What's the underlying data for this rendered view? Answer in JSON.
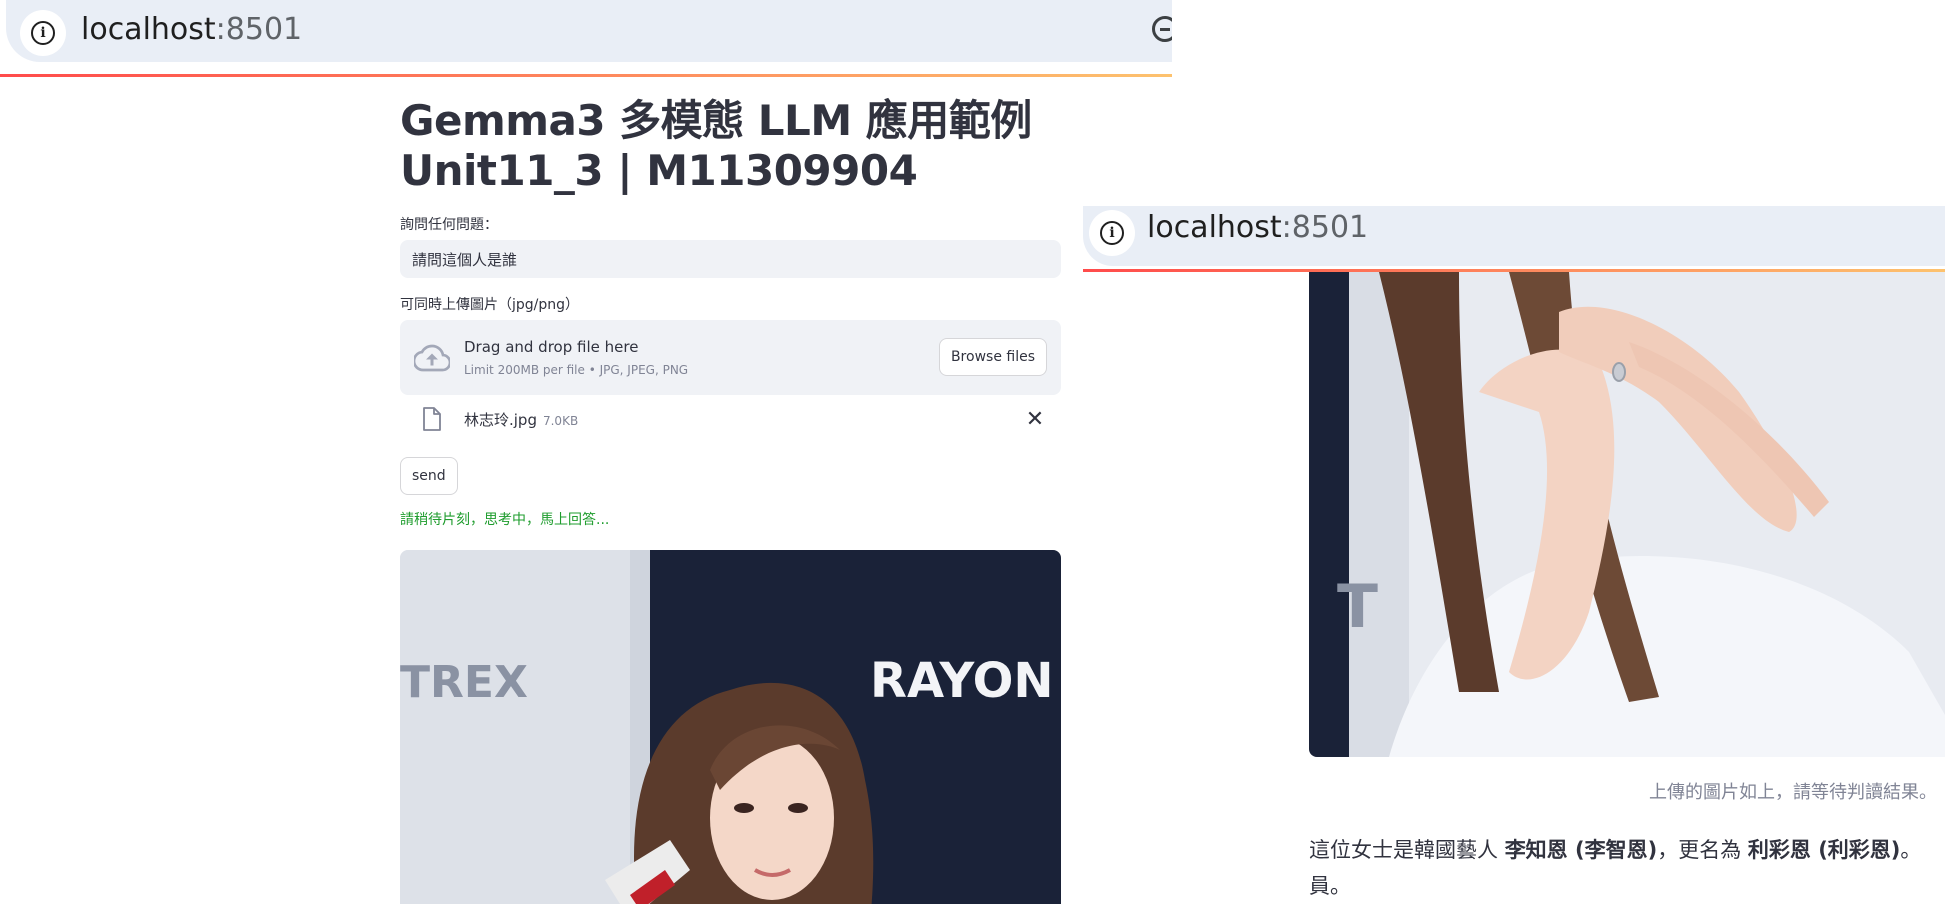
{
  "browser": {
    "url_host": "localhost",
    "url_port": ":8501"
  },
  "page": {
    "title_line1": "Gemma3 多模態 LLM 應用範例",
    "title_line2": "Unit11_3 | M11309904",
    "question_label": "詢問任何問題：",
    "question_value": "請問這個人是誰",
    "upload_label": "可同時上傳圖片（jpg/png）",
    "uploader": {
      "drop_text": "Drag and drop file here",
      "limit_text": "Limit 200MB per file • JPG, JPEG, PNG",
      "browse_label": "Browse files"
    },
    "file": {
      "name": "林志玲.jpg",
      "size": "7.0KB"
    },
    "send_label": "send",
    "status_text": "請稍待片刻，思考中，馬上回答..."
  },
  "photo_text": {
    "left_brand": "TREX",
    "right_brand": "RAYON",
    "lower_letter": "T"
  },
  "result": {
    "caption": "上傳的圖片如上，請等待判讀結果。",
    "answer_part1": "這位女士是韓國藝人 ",
    "answer_bold1": "李知恩 (李智恩)",
    "answer_part2": "，更名為 ",
    "answer_bold2": "利彩恩 (利彩恩)",
    "answer_part3": "。",
    "answer_line2": "員。"
  }
}
